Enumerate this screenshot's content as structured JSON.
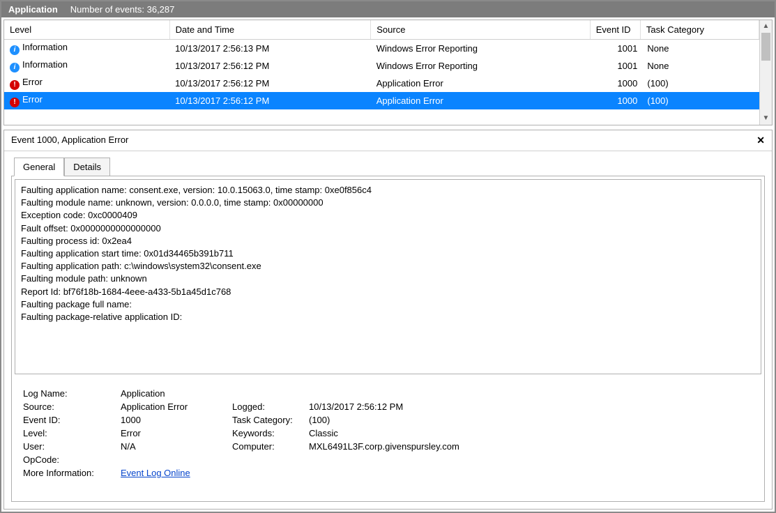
{
  "header": {
    "app_name": "Application",
    "events_label": "Number of events: 36,287"
  },
  "grid": {
    "columns": {
      "level": "Level",
      "date": "Date and Time",
      "source": "Source",
      "eventid": "Event ID",
      "task": "Task Category"
    },
    "rows": [
      {
        "icon": "info",
        "level": "Information",
        "date": "10/13/2017 2:56:13 PM",
        "source": "Windows Error Reporting",
        "eventid": "1001",
        "task": "None",
        "selected": false
      },
      {
        "icon": "info",
        "level": "Information",
        "date": "10/13/2017 2:56:12 PM",
        "source": "Windows Error Reporting",
        "eventid": "1001",
        "task": "None",
        "selected": false
      },
      {
        "icon": "error",
        "level": "Error",
        "date": "10/13/2017 2:56:12 PM",
        "source": "Application Error",
        "eventid": "1000",
        "task": "(100)",
        "selected": false
      },
      {
        "icon": "error",
        "level": "Error",
        "date": "10/13/2017 2:56:12 PM",
        "source": "Application Error",
        "eventid": "1000",
        "task": "(100)",
        "selected": true
      }
    ]
  },
  "detail": {
    "title": "Event 1000, Application Error",
    "tabs": {
      "general": "General",
      "details": "Details"
    },
    "description": "Faulting application name: consent.exe, version: 10.0.15063.0, time stamp: 0xe0f856c4\nFaulting module name: unknown, version: 0.0.0.0, time stamp: 0x00000000\nException code: 0xc0000409\nFault offset: 0x0000000000000000\nFaulting process id: 0x2ea4\nFaulting application start time: 0x01d34465b391b711\nFaulting application path: c:\\windows\\system32\\consent.exe\nFaulting module path: unknown\nReport Id: bf76f18b-1684-4eee-a433-5b1a45d1c768\nFaulting package full name: \nFaulting package-relative application ID: ",
    "props": {
      "log_name_label": "Log Name:",
      "log_name": "Application",
      "source_label": "Source:",
      "source": "Application Error",
      "logged_label": "Logged:",
      "logged": "10/13/2017 2:56:12 PM",
      "eventid_label": "Event ID:",
      "eventid": "1000",
      "taskcat_label": "Task Category:",
      "taskcat": "(100)",
      "level_label": "Level:",
      "level": "Error",
      "keywords_label": "Keywords:",
      "keywords": "Classic",
      "user_label": "User:",
      "user": "N/A",
      "computer_label": "Computer:",
      "computer": "MXL6491L3F.corp.givenspursley.com",
      "opcode_label": "OpCode:",
      "opcode": "",
      "moreinfo_label": "More Information:",
      "moreinfo_link": "Event Log Online "
    }
  }
}
